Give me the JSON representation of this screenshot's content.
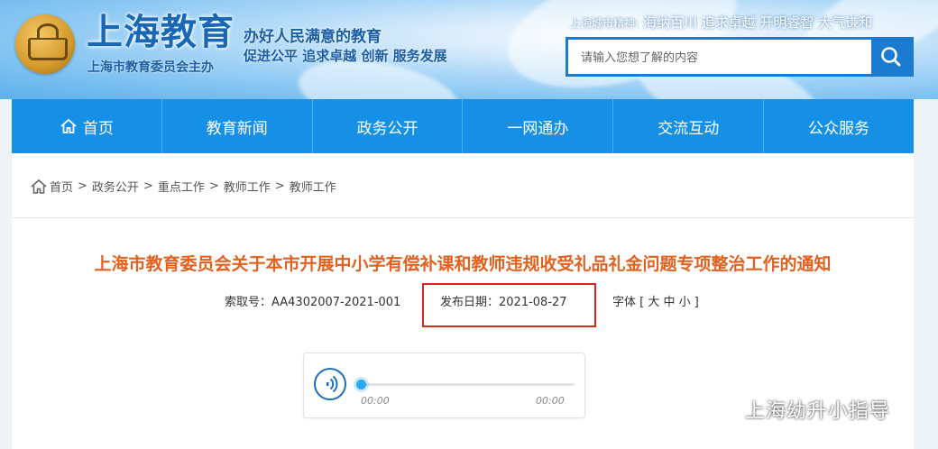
{
  "header": {
    "site_title": "上海教育",
    "site_subtitle": "上海市教育委员会主办",
    "slogan_line1": "办好人民满意的教育",
    "slogan_line2": "促进公平 追求卓越 创新 服务发展",
    "city_spirit_label": "上海城市精神:",
    "city_spirit_text": "海纳百川 追求卓越 开明睿智 大气谦和",
    "search_placeholder": "请输入您想了解的内容"
  },
  "nav": {
    "items": [
      {
        "label": "首页",
        "icon": "home-icon"
      },
      {
        "label": "教育新闻"
      },
      {
        "label": "政务公开"
      },
      {
        "label": "一网通办"
      },
      {
        "label": "交流互动"
      },
      {
        "label": "公众服务"
      }
    ]
  },
  "breadcrumb": [
    "首页",
    "政务公开",
    "重点工作",
    "教师工作",
    "教师工作"
  ],
  "article": {
    "title": "上海市教育委员会关于本市开展中小学有偿补课和教师违规收受礼品礼金问题专项整治工作的通知",
    "index_no": "索取号：AA4302007-2021-001",
    "publish_date": "发布日期：2021-08-27",
    "font_size": "字体 [ 大 中 小 ]"
  },
  "audio": {
    "current_time": "00:00",
    "duration": "00:00",
    "progress": 0
  },
  "watermark": "上海幼升小指导",
  "colors": {
    "nav_bg": "#1690e6",
    "title_orange": "#e2611f",
    "highlight_red": "#d9261c",
    "brand_blue": "#1a67b5"
  }
}
